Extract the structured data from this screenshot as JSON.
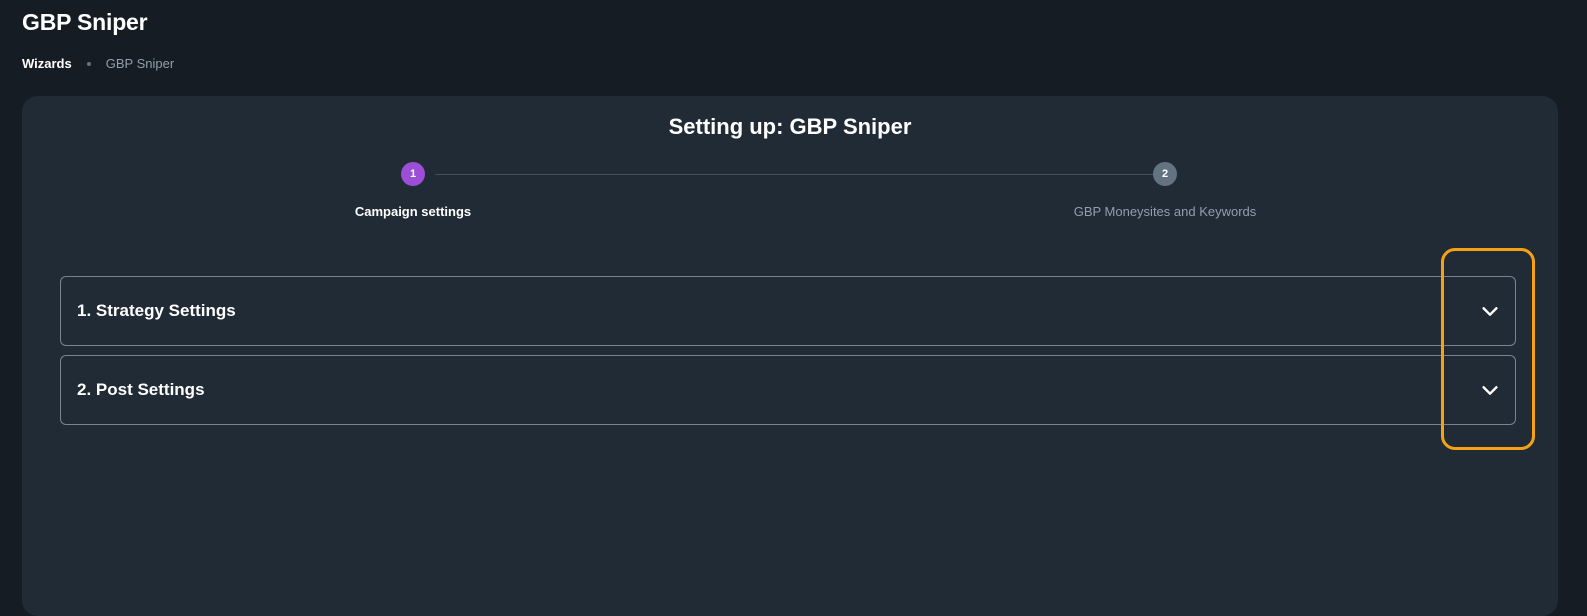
{
  "header": {
    "title": "GBP Sniper"
  },
  "breadcrumb": {
    "items": [
      {
        "label": "Wizards"
      },
      {
        "label": "GBP Sniper"
      }
    ]
  },
  "wizard": {
    "title": "Setting up: GBP Sniper",
    "steps": [
      {
        "number": "1",
        "label": "Campaign settings",
        "status": "active"
      },
      {
        "number": "2",
        "label": "GBP Moneysites and Keywords",
        "status": "inactive"
      }
    ],
    "sections": [
      {
        "title": "1. Strategy Settings",
        "icon": "chevron-down-icon"
      },
      {
        "title": "2. Post Settings",
        "icon": "chevron-down-icon"
      }
    ]
  },
  "colors": {
    "background": "#161c24",
    "card": "#212b36",
    "active_step": "#9c4fd6",
    "inactive_step": "#637381",
    "highlight": "#f5a315"
  }
}
